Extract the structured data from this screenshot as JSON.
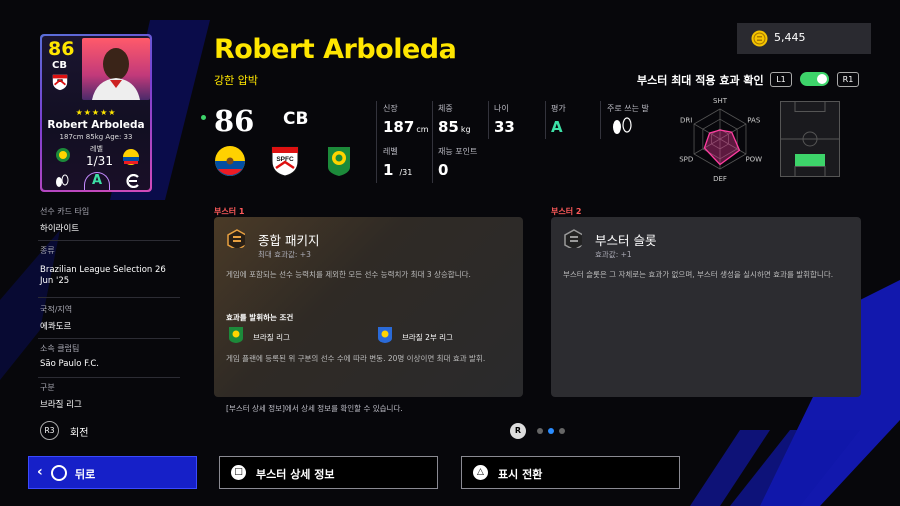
{
  "card": {
    "ovr": "86",
    "position": "CB",
    "stars": "★★★★★",
    "name": "Robert Arboleda",
    "info": "187cm 85kg Age: 33",
    "level_label": "레벨",
    "level": "1/31",
    "playstyle_grade": "A"
  },
  "details": {
    "card_type_label": "선수 카드 타입",
    "card_type": "하이라이트",
    "kind_label": "종류",
    "kind": "Brazilian League Selection 26 Jun '25",
    "nationality_label": "국적/지역",
    "nationality": "에콰도르",
    "club_label": "소속 클럽팀",
    "club": "São Paulo F.C.",
    "league_label": "구분",
    "league": "브라질 리그"
  },
  "rotate": {
    "key": "R3",
    "label": "회전"
  },
  "header": {
    "player_name": "Robert Arboleda",
    "subtitle": "강한 압박",
    "ovr": "86",
    "position": "CB"
  },
  "stats": {
    "height_label": "신장",
    "height": "187",
    "height_unit": "cm",
    "weight_label": "체중",
    "weight": "85",
    "weight_unit": "kg",
    "age_label": "나이",
    "age": "33",
    "rating_label": "평가",
    "rating": "A",
    "foot_label": "주로 쓰는 발",
    "level_label": "레벨",
    "level": "1",
    "level_max": "/31",
    "skill_points_label": "재능 포인트",
    "skill_points": "0"
  },
  "radar": {
    "labels": [
      "SHT",
      "PAS",
      "POW",
      "DEF",
      "SPD",
      "DRI"
    ],
    "values": [
      0.3,
      0.45,
      0.75,
      0.85,
      0.6,
      0.4
    ]
  },
  "coins": {
    "amount": "5,445"
  },
  "booster_toggle": {
    "label": "부스터 최대 적용 효과 확인",
    "key_left": "L1",
    "key_right": "R1",
    "enabled": true
  },
  "booster1": {
    "heading": "부스터 1",
    "title": "종합 패키지",
    "effect": "최대 효과값: +3",
    "description": "게임에 포함되는 선수 능력치를 제외한 모든 선수 능력치가 최대 3 상승합니다.",
    "condition_title": "효과를 발휘하는 조건",
    "cond1": "브라질 리그",
    "cond2": "브라질 2부 리그",
    "condition_desc": "게임 플랜에 등록된 위 구분의 선수 수에 따라 변동. 20명 이상이면 최대 효과 발휘."
  },
  "booster2": {
    "heading": "부스터 2",
    "title": "부스터 슬롯",
    "effect": "효과값: +1",
    "description": "부스터 슬롯은 그 자체로는 효과가 없으며, 부스터 생성을 실시하면 효과를 발휘합니다."
  },
  "footnote": "[부스터 상세 정보]에서 상세 정보를 확인할 수 있습니다.",
  "pager": {
    "key": "R"
  },
  "buttons": {
    "back": "뒤로",
    "booster_details": "부스터 상세 정보",
    "toggle_display": "표시 전환"
  },
  "colors": {
    "accent_yellow": "#ffe600",
    "back_blue": "#1620c8",
    "grade_green": "#3de0a6",
    "booster_red": "#ff5a5a"
  }
}
